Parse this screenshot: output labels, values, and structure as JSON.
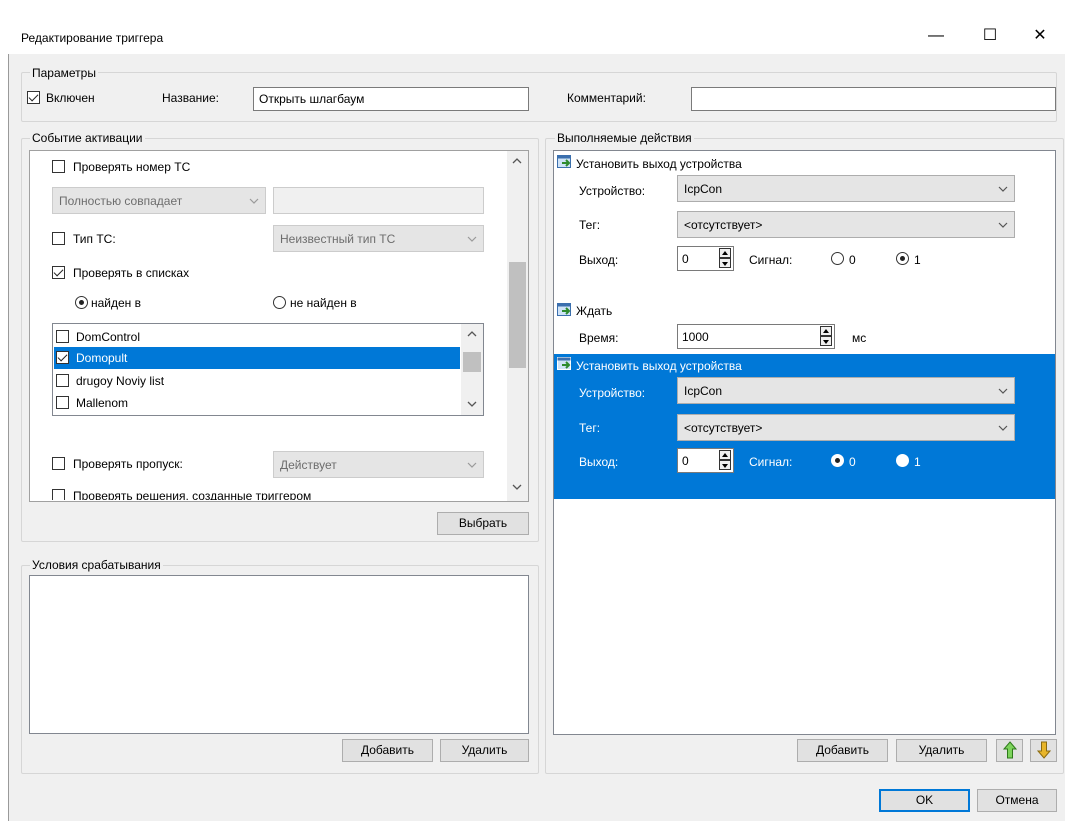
{
  "window": {
    "title": "Редактирование триггера",
    "minimize": "—",
    "maximize": "☐",
    "close": "✕"
  },
  "params": {
    "legend": "Параметры",
    "enabled_label": "Включен",
    "enabled": true,
    "name_label": "Название:",
    "name_value": "Открыть шлагбаум",
    "comment_label": "Комментарий:",
    "comment_value": ""
  },
  "activation": {
    "legend": "Событие активации",
    "check_plate_label": "Проверять номер ТС",
    "match_mode": "Полностью совпадает",
    "vehicle_type_label": "Тип ТС:",
    "vehicle_type_value": "Неизвестный тип ТС",
    "check_lists_label": "Проверять в списках",
    "found_in_label": "найден в",
    "not_found_in_label": "не найден в",
    "lists": [
      {
        "label": "DomControl",
        "checked": false,
        "selected": false
      },
      {
        "label": "Domopult",
        "checked": true,
        "selected": true
      },
      {
        "label": "drugoy Noviy list",
        "checked": false,
        "selected": false
      },
      {
        "label": "Mallenom",
        "checked": false,
        "selected": false
      }
    ],
    "check_pass_label": "Проверять пропуск:",
    "check_pass_value": "Действует",
    "check_decisions_label": "Проверять решения, созданные триггером",
    "select_button": "Выбрать"
  },
  "conditions": {
    "legend": "Условия срабатывания",
    "add_button": "Добавить",
    "delete_button": "Удалить"
  },
  "actions": {
    "legend": "Выполняемые действия",
    "items": [
      {
        "title": "Установить выход устройства",
        "device_label": "Устройство:",
        "device_value": "IcpCon",
        "tag_label": "Тег:",
        "tag_value": "<отсутствует>",
        "output_label": "Выход:",
        "output_value": "0",
        "signal_label": "Сигнал:",
        "signal_0": "0",
        "signal_1": "1",
        "signal_selected": "1"
      },
      {
        "title": "Ждать",
        "time_label": "Время:",
        "time_value": "1000",
        "unit": "мс"
      },
      {
        "title": "Установить выход устройства",
        "device_label": "Устройство:",
        "device_value": "IcpCon",
        "tag_label": "Тег:",
        "tag_value": "<отсутствует>",
        "output_label": "Выход:",
        "output_value": "0",
        "signal_label": "Сигнал:",
        "signal_0": "0",
        "signal_1": "1",
        "signal_selected": "0"
      }
    ],
    "add_button": "Добавить",
    "delete_button": "Удалить"
  },
  "footer": {
    "ok_button": "OK",
    "cancel_button": "Отмена"
  },
  "colors": {
    "selection": "#0078d7",
    "dialog_bg": "#f0f0f0"
  }
}
